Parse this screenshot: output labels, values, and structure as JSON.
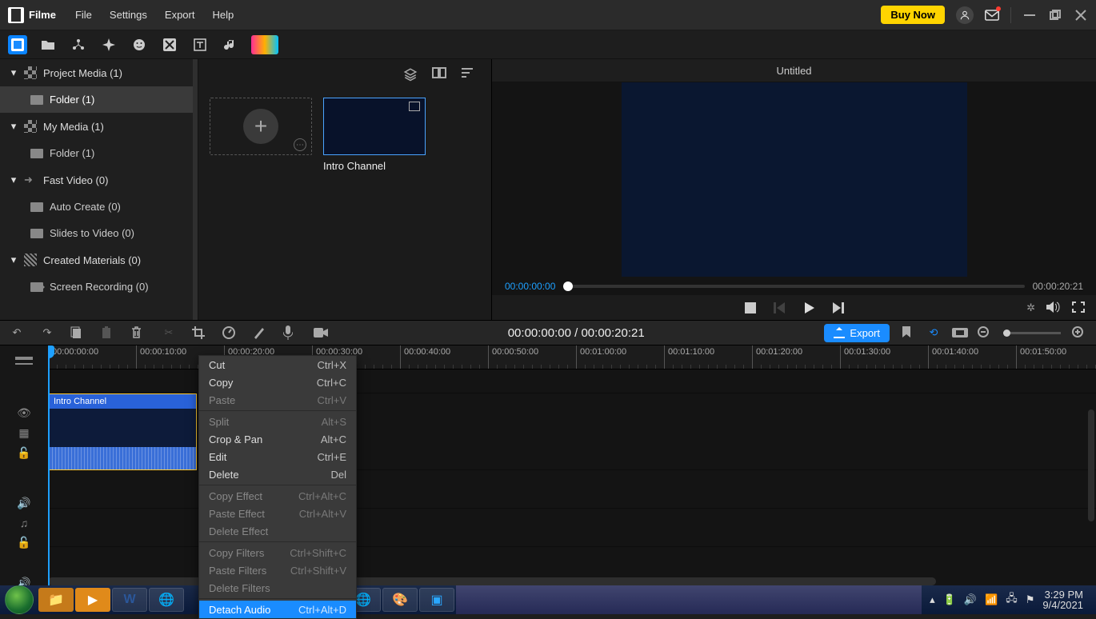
{
  "app": {
    "name": "Filme",
    "buy_now": "Buy Now"
  },
  "menubar": {
    "file": "File",
    "settings": "Settings",
    "export": "Export",
    "help": "Help"
  },
  "sidebar": {
    "groups": [
      {
        "label": "Project Media (1)",
        "children": [
          {
            "label": "Folder (1)",
            "selected": true
          }
        ]
      },
      {
        "label": "My Media (1)",
        "children": [
          {
            "label": "Folder (1)"
          }
        ]
      },
      {
        "label": "Fast Video (0)",
        "children": [
          {
            "label": "Auto Create (0)"
          },
          {
            "label": "Slides to Video (0)"
          }
        ]
      },
      {
        "label": "Created Materials (0)",
        "children": [
          {
            "label": "Screen Recording (0)"
          }
        ]
      }
    ]
  },
  "media": {
    "clip_label": "Intro Channel"
  },
  "preview": {
    "title": "Untitled",
    "time_current": "00:00:00:00",
    "time_total": "00:00:20:21"
  },
  "timeline_toolbar": {
    "time_display": "00:00:00:00 / 00:00:20:21",
    "export_label": "Export"
  },
  "ruler": {
    "ticks": [
      "00:00:00:00",
      "00:00:10:00",
      "00:00:20:00",
      "00:00:30:00",
      "00:00:40:00",
      "00:00:50:00",
      "00:01:00:00",
      "00:01:10:00",
      "00:01:20:00",
      "00:01:30:00",
      "00:01:40:00",
      "00:01:50:00"
    ]
  },
  "timeline": {
    "clip_label": "Intro Channel"
  },
  "context_menu": {
    "items": [
      {
        "label": "Cut",
        "shortcut": "Ctrl+X"
      },
      {
        "label": "Copy",
        "shortcut": "Ctrl+C"
      },
      {
        "label": "Paste",
        "shortcut": "Ctrl+V",
        "disabled": true
      },
      {
        "sep": true
      },
      {
        "label": "Split",
        "shortcut": "Alt+S",
        "disabled": true
      },
      {
        "label": "Crop & Pan",
        "shortcut": "Alt+C"
      },
      {
        "label": "Edit",
        "shortcut": "Ctrl+E"
      },
      {
        "label": "Delete",
        "shortcut": "Del"
      },
      {
        "sep": true
      },
      {
        "label": "Copy Effect",
        "shortcut": "Ctrl+Alt+C",
        "disabled": true
      },
      {
        "label": "Paste Effect",
        "shortcut": "Ctrl+Alt+V",
        "disabled": true
      },
      {
        "label": "Delete Effect",
        "shortcut": "",
        "disabled": true
      },
      {
        "sep": true
      },
      {
        "label": "Copy Filters",
        "shortcut": "Ctrl+Shift+C",
        "disabled": true
      },
      {
        "label": "Paste Filters",
        "shortcut": "Ctrl+Shift+V",
        "disabled": true
      },
      {
        "label": "Delete Filters",
        "shortcut": "",
        "disabled": true
      },
      {
        "sep": true
      },
      {
        "label": "Detach Audio",
        "shortcut": "Ctrl+Alt+D",
        "highlight": true
      }
    ]
  },
  "taskbar": {
    "time": "3:29 PM",
    "date": "9/4/2021"
  }
}
